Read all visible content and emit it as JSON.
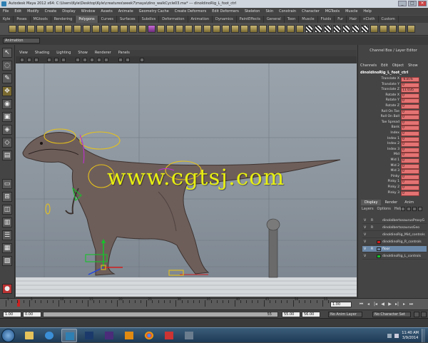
{
  "window": {
    "title": "Autodesk Maya 2012 x64: C:\\Users\\Kyle\\Desktop\\Kyle\\creatures\\week7\\maya\\dino_walkCycle03.ma* --- dinoIdinoRig_L_foot_ctrl"
  },
  "menubar": [
    "File",
    "Edit",
    "Modify",
    "Create",
    "Display",
    "Window",
    "Assets",
    "Animate",
    "Geometry Cache",
    "Create Deformers",
    "Edit Deformers",
    "Skeleton",
    "Skin",
    "Constrain",
    "Character",
    "MGTools",
    "Muscle",
    "Help"
  ],
  "shelf_tabs": [
    {
      "label": "Kyle",
      "active": false
    },
    {
      "label": "Poses",
      "active": false
    },
    {
      "label": "MGtools",
      "active": false
    },
    {
      "label": "Rendering",
      "active": false
    },
    {
      "label": "Polygons",
      "active": true
    },
    {
      "label": "Curves",
      "active": false
    },
    {
      "label": "Surfaces",
      "active": false
    },
    {
      "label": "Subdivs",
      "active": false
    },
    {
      "label": "Deformation",
      "active": false
    },
    {
      "label": "Animation",
      "active": false
    },
    {
      "label": "Dynamics",
      "active": false
    },
    {
      "label": "PaintEffects",
      "active": false
    },
    {
      "label": "General",
      "active": false
    },
    {
      "label": "Toon",
      "active": false
    },
    {
      "label": "Muscle",
      "active": false
    },
    {
      "label": "Fluids",
      "active": false
    },
    {
      "label": "Fur",
      "active": false
    },
    {
      "label": "Hair",
      "active": false
    },
    {
      "label": "nCloth",
      "active": false
    },
    {
      "label": "Custom",
      "active": false
    }
  ],
  "menu_set": "Animation",
  "panel_menu": [
    "View",
    "Shading",
    "Lighting",
    "Show",
    "Renderer",
    "Panels"
  ],
  "watermark": "www.cgtsj.com",
  "channel_box": {
    "title": "Channel Box / Layer Editor",
    "tabs": [
      "Channels",
      "Edit",
      "Object",
      "Show"
    ],
    "node": "dinoIdinoRig_L_foot_ctrl",
    "attributes": [
      {
        "label": "Translate X",
        "value": "-6.876"
      },
      {
        "label": "Translate Y",
        "value": "0"
      },
      {
        "label": "Translate Z",
        "value": "11.035"
      },
      {
        "label": "Rotate X",
        "value": "0"
      },
      {
        "label": "Rotate Y",
        "value": "0"
      },
      {
        "label": "Rotate Z",
        "value": "0"
      },
      {
        "label": "Roll On Toe",
        "value": "0"
      },
      {
        "label": "Roll On Ball",
        "value": "0"
      },
      {
        "label": "Toe Spread",
        "value": "0"
      },
      {
        "label": "Bank",
        "value": "0"
      },
      {
        "label": "Index",
        "value": "0"
      },
      {
        "label": "Index 1",
        "value": "0"
      },
      {
        "label": "Index 2",
        "value": "0"
      },
      {
        "label": "Index 3",
        "value": "0"
      },
      {
        "label": "Mid",
        "value": "0"
      },
      {
        "label": "Mid 1",
        "value": "0"
      },
      {
        "label": "Mid 2",
        "value": "0"
      },
      {
        "label": "Mid 3",
        "value": "0"
      },
      {
        "label": "Pinky",
        "value": "0"
      },
      {
        "label": "Pinky 1",
        "value": "0"
      },
      {
        "label": "Pinky 2",
        "value": "0"
      },
      {
        "label": "Pinky 3",
        "value": "0"
      }
    ]
  },
  "layer_editor": {
    "tabs": [
      {
        "label": "Display",
        "active": true
      },
      {
        "label": "Render",
        "active": false
      },
      {
        "label": "Anim",
        "active": false
      }
    ],
    "menu": [
      "Layers",
      "Options",
      "Help"
    ],
    "layers": [
      {
        "v": "V",
        "r": "R",
        "color": "",
        "name": "dinoIalbertosaurusProxyG",
        "selected": false
      },
      {
        "v": "V",
        "r": "R",
        "color": "",
        "name": "dinoIalbertosaurusGeo",
        "selected": false
      },
      {
        "v": "V",
        "r": "",
        "color": "",
        "name": "dinoIdinoRig_Mid_controls",
        "selected": false
      },
      {
        "v": "V",
        "r": "",
        "color": "#d21f1f",
        "name": "dinoIdinoRig_R_controls",
        "selected": false
      },
      {
        "v": "V",
        "r": "R",
        "color": "#6b88a8",
        "name": "floor",
        "selected": true
      },
      {
        "v": "V",
        "r": "",
        "color": "#17c22b",
        "name": "dinoIdinoRig_L_controls",
        "selected": false
      }
    ]
  },
  "time_slider": {
    "tick_labels": [
      "1",
      "5",
      "10",
      "15",
      "20",
      "25",
      "30",
      "35",
      "40",
      "45",
      "50",
      "55"
    ],
    "current_frame_field": "1.00",
    "current_frame": 2,
    "range_max": 56
  },
  "range_slider": {
    "start_time": "1.00",
    "playback_start": "0.00",
    "bar_end_label": "55",
    "playback_end": "55.00",
    "end_time": "56.00",
    "anim_layer": "No Anim Layer",
    "character_set": "No Character Set"
  },
  "taskbar": {
    "time": "11:40 AM",
    "date": "3/9/2014"
  }
}
